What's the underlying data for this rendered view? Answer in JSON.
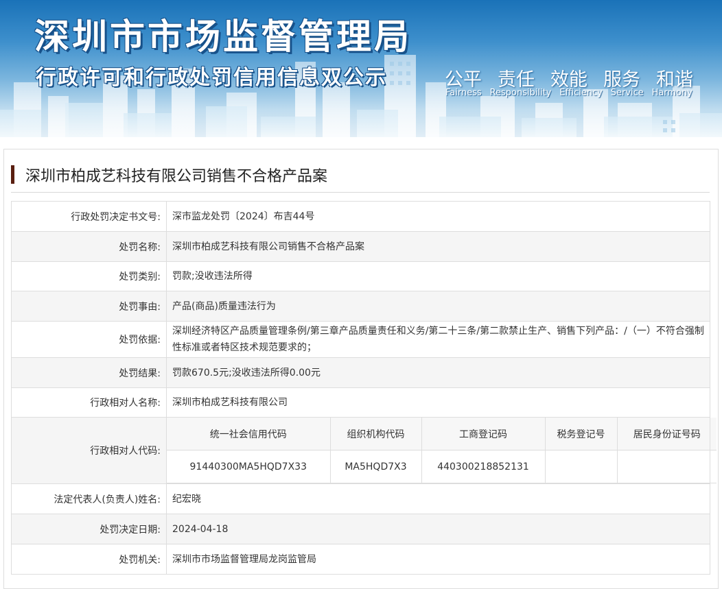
{
  "banner": {
    "title": "深圳市市场监督管理局",
    "subtitle": "行政许可和行政处罚信用信息双公示",
    "values_cn": [
      "公平",
      "责任",
      "效能",
      "服务",
      "和谐"
    ],
    "values_en": [
      "Fairness",
      "Responsibility",
      "Efficiency",
      "Service",
      "Harmony"
    ],
    "colors": {
      "sky_top": "#1a72b8",
      "sky_bottom": "#e2eef6",
      "title_outline": "#17518a"
    }
  },
  "case": {
    "title": "深圳市柏成艺科技有限公司销售不合格产品案",
    "accent_color": "#5a1f10"
  },
  "fields": {
    "decision_no": {
      "label": "行政处罚决定书文号:",
      "value": "深市监龙处罚〔2024〕布吉44号"
    },
    "penalty_name": {
      "label": "处罚名称:",
      "value": "深圳市柏成艺科技有限公司销售不合格产品案"
    },
    "penalty_type": {
      "label": "处罚类别:",
      "value": "罚款;没收违法所得"
    },
    "penalty_reason": {
      "label": "处罚事由:",
      "value": "产品(商品)质量违法行为"
    },
    "penalty_basis": {
      "label": "处罚依据:",
      "value": "深圳经济特区产品质量管理条例/第三章产品质量责任和义务/第二十三条/第二款禁止生产、销售下列产品：/（一）不符合强制性标准或者特区技术规范要求的；"
    },
    "penalty_result": {
      "label": "处罚结果:",
      "value": "罚款670.5元;没收违法所得0.00元"
    },
    "party_name": {
      "label": "行政相对人名称:",
      "value": "深圳市柏成艺科技有限公司"
    },
    "party_codes": {
      "label": "行政相对人代码:",
      "headers": [
        "统一社会信用代码",
        "组织机构代码",
        "工商登记码",
        "税务登记号",
        "居民身份证号码"
      ],
      "values": [
        "91440300MA5HQD7X33",
        "MA5HQD7X3",
        "440300218852131",
        "",
        ""
      ]
    },
    "legal_rep": {
      "label": "法定代表人(负责人)姓名:",
      "value": "纪宏晓"
    },
    "decision_date": {
      "label": "处罚决定日期:",
      "value": "2024-04-18"
    },
    "authority": {
      "label": "处罚机关:",
      "value": "深圳市市场监督管理局龙岗监管局"
    }
  }
}
